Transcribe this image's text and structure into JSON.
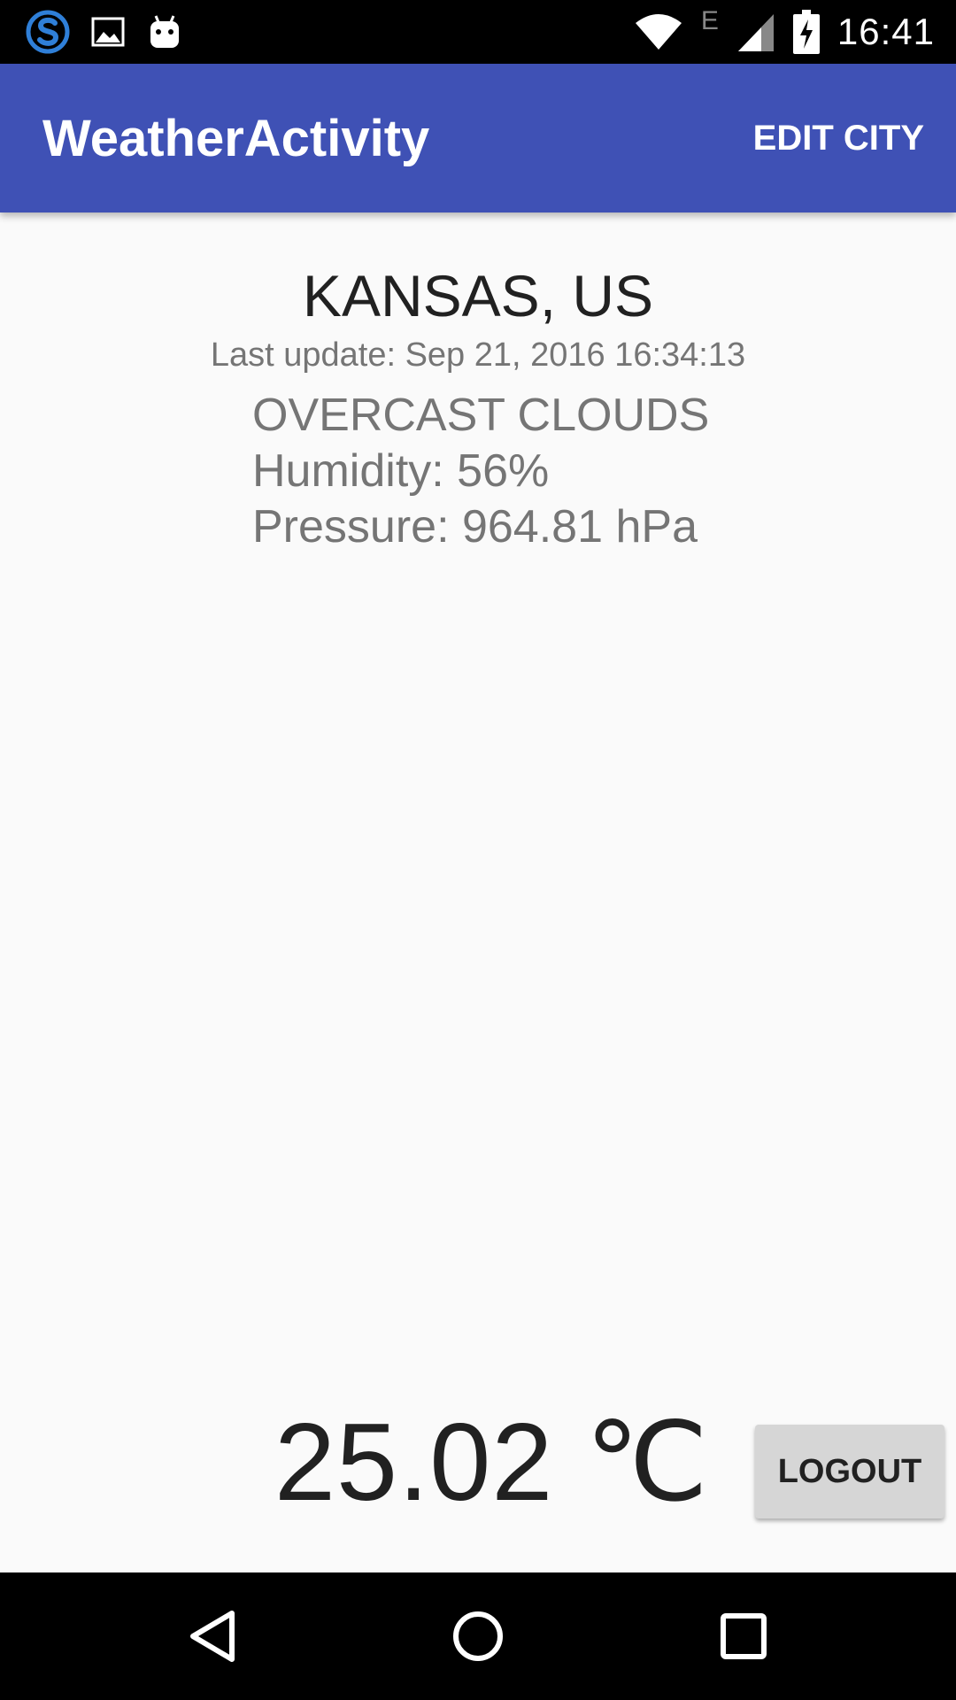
{
  "status_bar": {
    "time": "16:41",
    "network_type": "E",
    "left_icons": [
      "skype-icon",
      "image-icon",
      "android-icon"
    ],
    "right_icons": [
      "wifi-icon",
      "cell-signal-icon",
      "battery-charging-icon"
    ]
  },
  "app_bar": {
    "title": "WeatherActivity",
    "action_label": "EDIT CITY",
    "color": "#3f51b5"
  },
  "weather": {
    "city": "KANSAS, US",
    "last_update": "Last update: Sep 21, 2016 16:34:13",
    "description": "OVERCAST CLOUDS",
    "humidity": "Humidity: 56%",
    "pressure": "Pressure: 964.81 hPa",
    "temperature": "25.02 ℃"
  },
  "logout_label": "LOGOUT",
  "nav_bar": {
    "buttons": [
      "back-icon",
      "home-icon",
      "recents-icon"
    ]
  }
}
